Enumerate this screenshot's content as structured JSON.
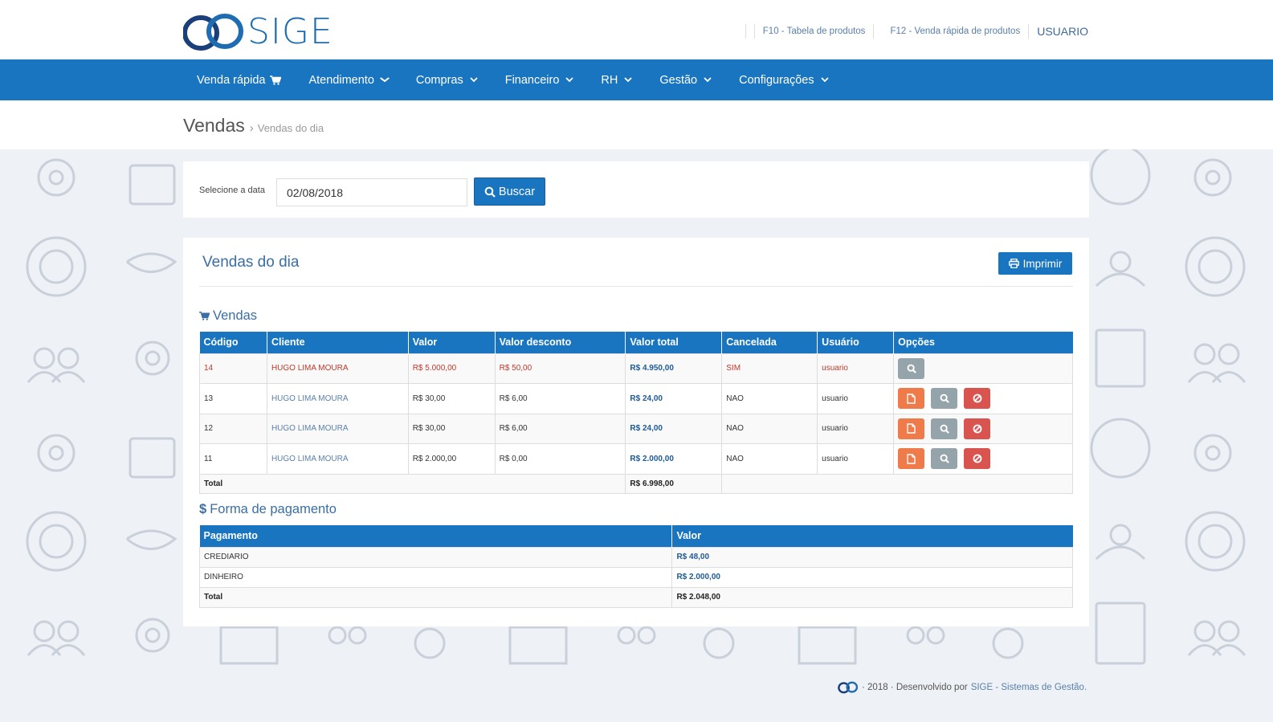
{
  "header": {
    "logo_text": "SIGE",
    "links": [
      "F10 - Tabela de produtos",
      "F12 - Venda rápida de produtos"
    ],
    "user": "USUARIO"
  },
  "nav": {
    "items": [
      {
        "label": "Venda rápida",
        "icon": "cart-icon"
      },
      {
        "label": "Atendimento",
        "icon": "chevron-down-icon"
      },
      {
        "label": "Compras",
        "icon": "chevron-down-icon"
      },
      {
        "label": "Financeiro",
        "icon": "chevron-down-icon"
      },
      {
        "label": "RH",
        "icon": "chevron-down-icon"
      },
      {
        "label": "Gestão",
        "icon": "chevron-down-icon"
      },
      {
        "label": "Configurações",
        "icon": "chevron-down-icon"
      }
    ]
  },
  "breadcrumb": {
    "main": "Vendas",
    "sub": "Vendas do dia"
  },
  "search": {
    "label": "Selecione a data",
    "date_value": "02/08/2018",
    "button": "Buscar"
  },
  "panel": {
    "title": "Vendas do dia",
    "print_button": "Imprimir"
  },
  "vendas": {
    "section_title": "Vendas",
    "columns": [
      "Código",
      "Cliente",
      "Valor",
      "Valor desconto",
      "Valor total",
      "Cancelada",
      "Usuário",
      "Opções"
    ],
    "rows": [
      {
        "codigo": "14",
        "cliente": "HUGO LIMA MOURA",
        "valor": "R$ 5.000,00",
        "desconto": "R$ 50,00",
        "total": "R$ 4.950,00",
        "cancelada": "SIM",
        "usuario": "usuario",
        "canceled": true
      },
      {
        "codigo": "13",
        "cliente": "HUGO LIMA MOURA",
        "valor": "R$ 30,00",
        "desconto": "R$ 6,00",
        "total": "R$ 24,00",
        "cancelada": "NAO",
        "usuario": "usuario",
        "canceled": false
      },
      {
        "codigo": "12",
        "cliente": "HUGO LIMA MOURA",
        "valor": "R$ 30,00",
        "desconto": "R$ 6,00",
        "total": "R$ 24,00",
        "cancelada": "NAO",
        "usuario": "usuario",
        "canceled": false
      },
      {
        "codigo": "11",
        "cliente": "HUGO LIMA MOURA",
        "valor": "R$ 2.000,00",
        "desconto": "R$ 0,00",
        "total": "R$ 2.000,00",
        "cancelada": "NAO",
        "usuario": "usuario",
        "canceled": false
      }
    ],
    "total_label": "Total",
    "total_value": "R$ 6.998,00"
  },
  "pagamento": {
    "section_title": "Forma de pagamento",
    "columns": [
      "Pagamento",
      "Valor"
    ],
    "rows": [
      {
        "tipo": "CREDIARIO",
        "valor": "R$ 48,00"
      },
      {
        "tipo": "DINHEIRO",
        "valor": "R$ 2.000,00"
      }
    ],
    "total_label": "Total",
    "total_value": "R$ 2.048,00"
  },
  "footer": {
    "text": "· 2018 · Desenvolvido por",
    "link": "SIGE - Sistemas de Gestão."
  },
  "colors": {
    "primary": "#1975c0",
    "orange": "#ee7b49",
    "gray": "#95a3ab",
    "red": "#d9534f"
  }
}
